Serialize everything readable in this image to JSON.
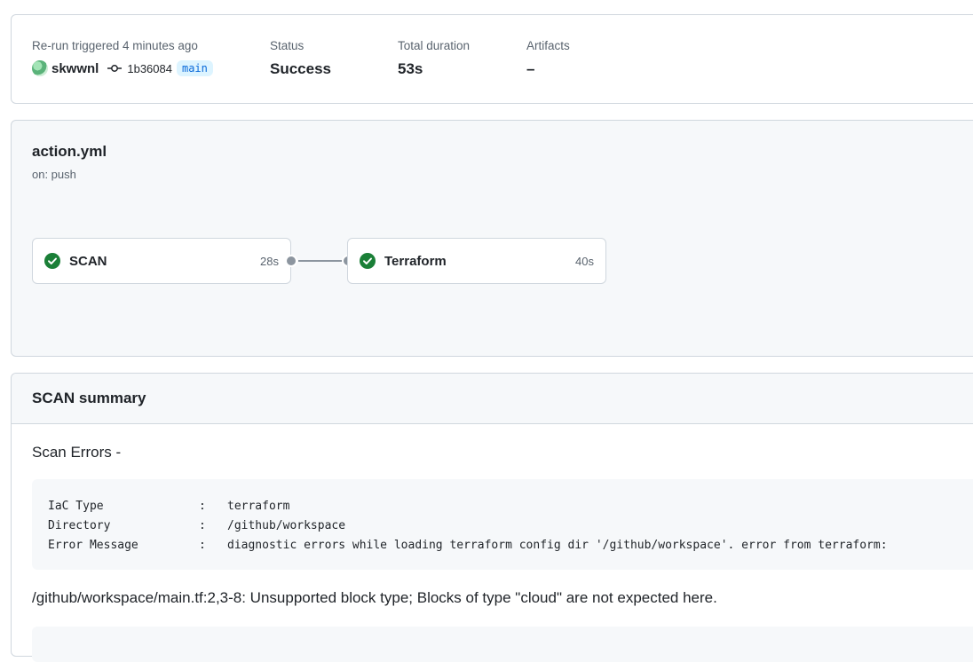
{
  "summary": {
    "trigger_label": "Re-run triggered 4 minutes ago",
    "actor": "skwwnl",
    "commit_sha": "1b36084",
    "branch": "main",
    "status_label": "Status",
    "status_value": "Success",
    "duration_label": "Total duration",
    "duration_value": "53s",
    "artifacts_label": "Artifacts",
    "artifacts_value": "–"
  },
  "workflow": {
    "file": "action.yml",
    "trigger": "on: push",
    "jobs": [
      {
        "name": "SCAN",
        "duration": "28s",
        "status": "success"
      },
      {
        "name": "Terraform",
        "duration": "40s",
        "status": "success"
      }
    ]
  },
  "scan_summary": {
    "title": "SCAN summary",
    "errors_heading": "Scan Errors -",
    "error_table": [
      {
        "key": "IaC Type",
        "value": "terraform"
      },
      {
        "key": "Directory",
        "value": "/github/workspace"
      },
      {
        "key": "Error Message",
        "value": "diagnostic errors while loading terraform config dir '/github/workspace'. error from terraform:"
      }
    ],
    "error_detail": "/github/workspace/main.tf:2,3-8: Unsupported block type; Blocks of type \"cloud\" are not expected here."
  },
  "colors": {
    "success": "#1a7f37",
    "border": "#d0d7de",
    "muted_bg": "#f6f8fa",
    "branch_bg": "#ddf4ff",
    "branch_fg": "#0969da"
  }
}
